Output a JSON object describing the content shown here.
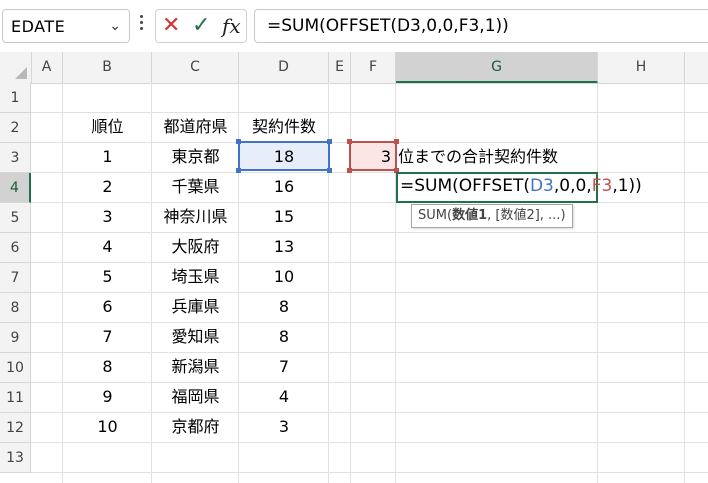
{
  "namebox": {
    "value": "EDATE"
  },
  "formula_bar": {
    "cancel_icon": "✕",
    "enter_icon": "✓",
    "fx_label": "fx",
    "formula": "=SUM(OFFSET(D3,0,0,F3,1))"
  },
  "columns": [
    "A",
    "B",
    "C",
    "D",
    "E",
    "F",
    "G",
    "H"
  ],
  "active_column": "G",
  "rows": [
    "1",
    "2",
    "3",
    "4",
    "5",
    "6",
    "7",
    "8",
    "9",
    "10",
    "11",
    "12",
    "13"
  ],
  "active_row": "4",
  "table": {
    "headers": {
      "rank": "順位",
      "prefecture": "都道府県",
      "contracts": "契約件数"
    },
    "rows": [
      {
        "rank": "1",
        "prefecture": "東京都",
        "contracts": "18"
      },
      {
        "rank": "2",
        "prefecture": "千葉県",
        "contracts": "16"
      },
      {
        "rank": "3",
        "prefecture": "神奈川県",
        "contracts": "15"
      },
      {
        "rank": "4",
        "prefecture": "大阪府",
        "contracts": "13"
      },
      {
        "rank": "5",
        "prefecture": "埼玉県",
        "contracts": "10"
      },
      {
        "rank": "6",
        "prefecture": "兵庫県",
        "contracts": "8"
      },
      {
        "rank": "7",
        "prefecture": "愛知県",
        "contracts": "8"
      },
      {
        "rank": "8",
        "prefecture": "新潟県",
        "contracts": "7"
      },
      {
        "rank": "9",
        "prefecture": "福岡県",
        "contracts": "4"
      },
      {
        "rank": "10",
        "prefecture": "京都府",
        "contracts": "3"
      }
    ]
  },
  "input": {
    "value": "3",
    "label": "位までの合計契約件数"
  },
  "editing": {
    "prefix": "=SUM(OFFSET(",
    "ref1": "D3",
    "mid": ",0,0,",
    "ref2": "F3",
    "suffix": ",1))"
  },
  "tooltip": {
    "fn": "SUM(",
    "arg1": "数値1",
    "rest": ", [数値2], ...)"
  },
  "colors": {
    "excel_green": "#217346",
    "ref_blue": "#4472c4",
    "ref_red": "#c0504d"
  }
}
